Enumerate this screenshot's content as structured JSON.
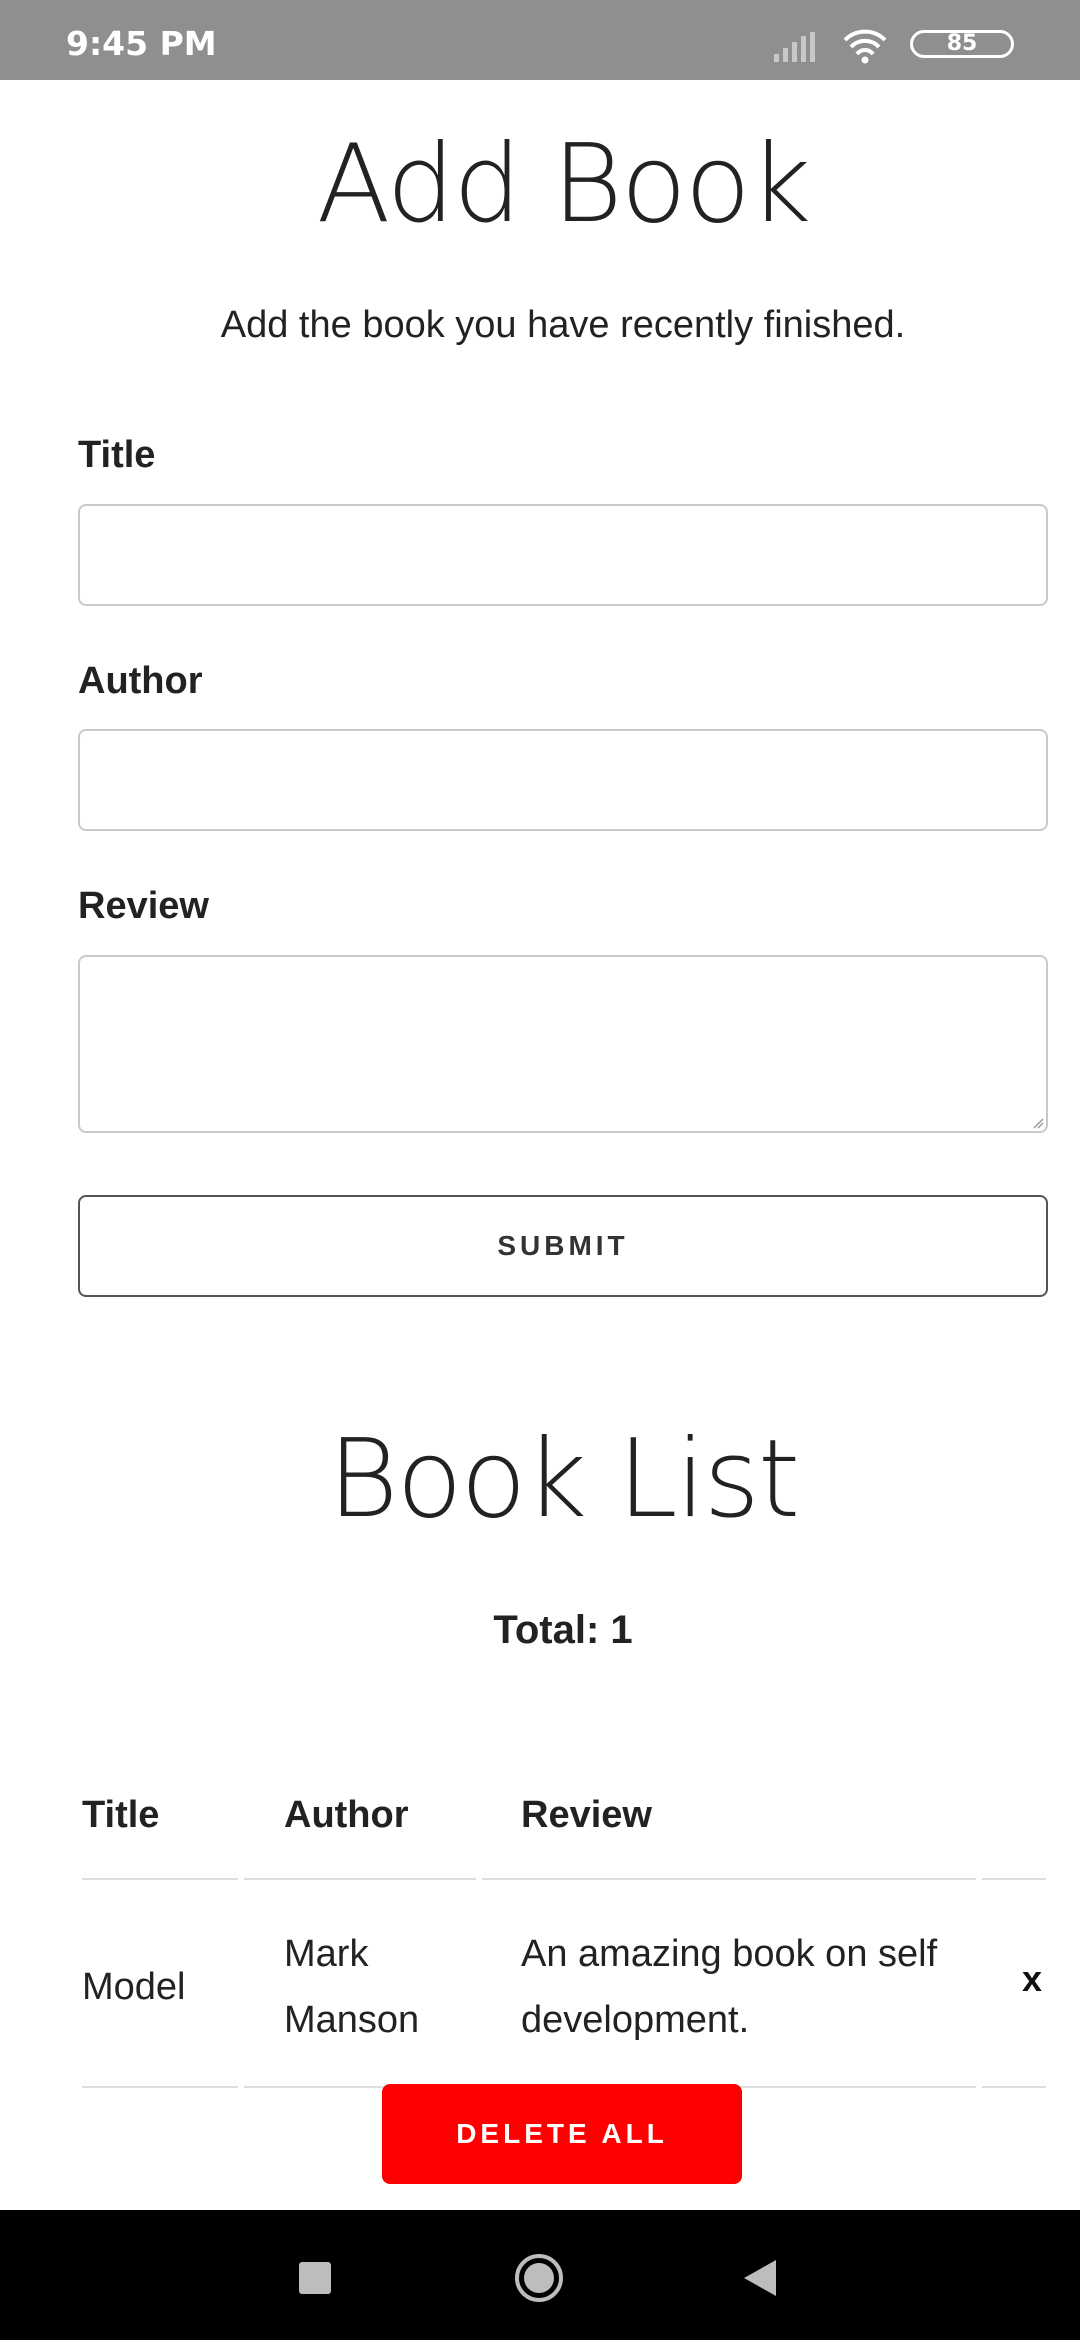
{
  "status_bar": {
    "time": "9:45 PM",
    "battery": "85"
  },
  "form": {
    "title": "Add Book",
    "subtitle": "Add the book you have recently finished.",
    "fields": {
      "title_label": "Title",
      "title_value": "",
      "author_label": "Author",
      "author_value": "",
      "review_label": "Review",
      "review_value": ""
    },
    "submit_label": "SUBMIT"
  },
  "book_list": {
    "title": "Book List",
    "total": "Total: 1",
    "columns": [
      "Title",
      "Author",
      "Review"
    ],
    "rows": [
      {
        "title": "Model",
        "author": "Mark Manson",
        "review": "An amazing book on self development.",
        "delete_label": "x"
      }
    ],
    "delete_all_label": "DELETE ALL"
  },
  "colors": {
    "status_bar_bg": "#8f8f8f",
    "delete_all_bg": "#ff0000",
    "nav_bar_bg": "#000000"
  },
  "icons": [
    "signal-icon",
    "wifi-icon",
    "battery-icon",
    "resize-handle-icon",
    "recents-icon",
    "home-icon",
    "back-icon"
  ]
}
